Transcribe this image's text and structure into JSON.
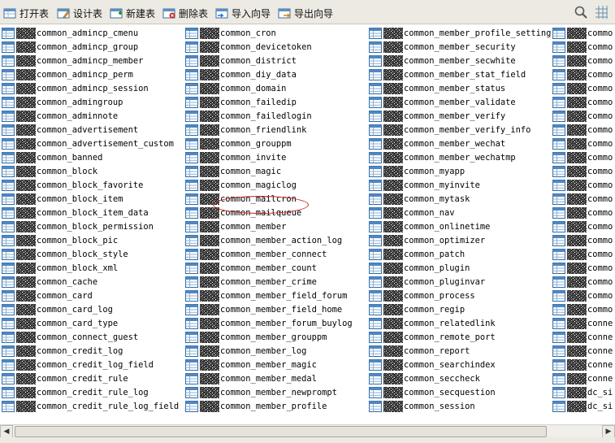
{
  "toolbar": {
    "buttons": [
      {
        "label": "打开表",
        "icon": "open-table-icon"
      },
      {
        "label": "设计表",
        "icon": "design-table-icon"
      },
      {
        "label": "新建表",
        "icon": "new-table-icon"
      },
      {
        "label": "删除表",
        "icon": "delete-table-icon"
      },
      {
        "label": "导入向导",
        "icon": "import-wizard-icon"
      },
      {
        "label": "导出向导",
        "icon": "export-wizard-icon"
      }
    ],
    "right_icons": [
      "search-icon",
      "grid-view-icon"
    ]
  },
  "colors": {
    "accent": "#3c78b4",
    "highlight": "#cc2020"
  },
  "columns": [
    [
      "common_admincp_cmenu",
      "common_admincp_group",
      "common_admincp_member",
      "common_admincp_perm",
      "common_admincp_session",
      "common_admingroup",
      "common_adminnote",
      "common_advertisement",
      "common_advertisement_custom",
      "common_banned",
      "common_block",
      "common_block_favorite",
      "common_block_item",
      "common_block_item_data",
      "common_block_permission",
      "common_block_pic",
      "common_block_style",
      "common_block_xml",
      "common_cache",
      "common_card",
      "common_card_log",
      "common_card_type",
      "common_connect_guest",
      "common_credit_log",
      "common_credit_log_field",
      "common_credit_rule",
      "common_credit_rule_log",
      "common_credit_rule_log_field"
    ],
    [
      "common_cron",
      "common_devicetoken",
      "common_district",
      "common_diy_data",
      "common_domain",
      "common_failedip",
      "common_failedlogin",
      "common_friendlink",
      "common_grouppm",
      "common_invite",
      "common_magic",
      "common_magiclog",
      "common_mailcron",
      "common_mailqueue",
      "common_member",
      "common_member_action_log",
      "common_member_connect",
      "common_member_count",
      "common_member_crime",
      "common_member_field_forum",
      "common_member_field_home",
      "common_member_forum_buylog",
      "common_member_grouppm",
      "common_member_log",
      "common_member_magic",
      "common_member_medal",
      "common_member_newprompt",
      "common_member_profile"
    ],
    [
      "common_member_profile_setting",
      "common_member_security",
      "common_member_secwhite",
      "common_member_stat_field",
      "common_member_status",
      "common_member_validate",
      "common_member_verify",
      "common_member_verify_info",
      "common_member_wechat",
      "common_member_wechatmp",
      "common_myapp",
      "common_myinvite",
      "common_mytask",
      "common_nav",
      "common_onlinetime",
      "common_optimizer",
      "common_patch",
      "common_plugin",
      "common_pluginvar",
      "common_process",
      "common_regip",
      "common_relatedlink",
      "common_remote_port",
      "common_report",
      "common_searchindex",
      "common_seccheck",
      "common_secquestion",
      "common_session"
    ],
    [
      "commo",
      "commo",
      "commo",
      "commo",
      "commo",
      "commo",
      "commo",
      "commo",
      "commo",
      "commo",
      "commo",
      "commo",
      "commo",
      "commo",
      "commo",
      "commo",
      "commo",
      "commo",
      "commo",
      "commo",
      "commo",
      "conne",
      "conne",
      "conne",
      "conne",
      "conne",
      "dc_si",
      "dc_si"
    ]
  ],
  "selected": "common_member"
}
